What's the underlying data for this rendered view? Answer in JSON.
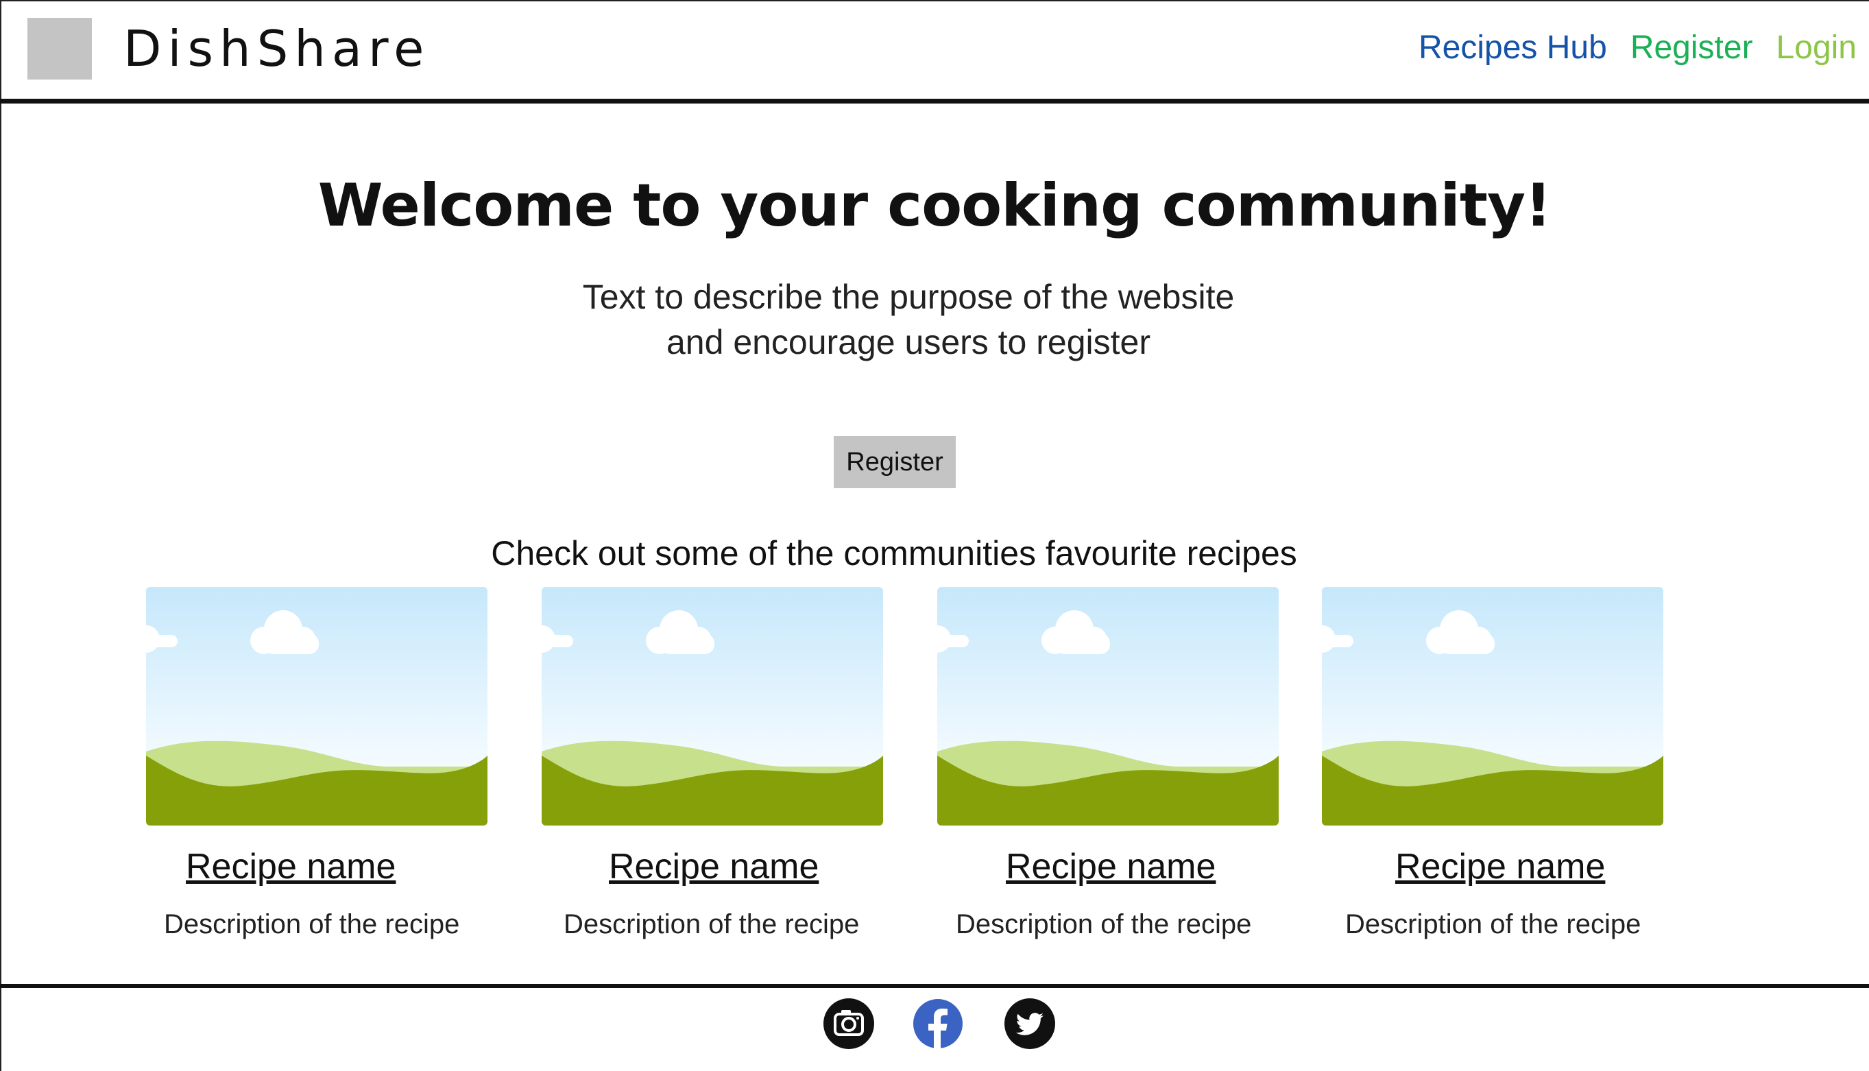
{
  "header": {
    "brand": "DishShare",
    "nav": [
      {
        "label": "Recipes Hub",
        "color": "#1553a8"
      },
      {
        "label": "Register",
        "color": "#1bb056"
      },
      {
        "label": "Login",
        "color": "#8cc646"
      }
    ]
  },
  "hero": {
    "title": "Welcome to your cooking community!",
    "text_line1": "Text to describe the purpose of the website",
    "text_line2": "and encourage users to register",
    "register_button": "Register"
  },
  "recipes": {
    "heading": "Check out some of the communities favourite recipes",
    "items": [
      {
        "name": "Recipe name",
        "description": "Description of the recipe",
        "image_icon": "landscape-placeholder-icon"
      },
      {
        "name": "Recipe name",
        "description": "Description of the recipe",
        "image_icon": "landscape-placeholder-icon"
      },
      {
        "name": "Recipe name",
        "description": "Description of the recipe",
        "image_icon": "landscape-placeholder-icon"
      },
      {
        "name": "Recipe name",
        "description": "Description of the recipe",
        "image_icon": "landscape-placeholder-icon"
      }
    ]
  },
  "footer": {
    "social_icons": [
      "instagram-icon",
      "facebook-icon",
      "twitter-icon"
    ]
  }
}
